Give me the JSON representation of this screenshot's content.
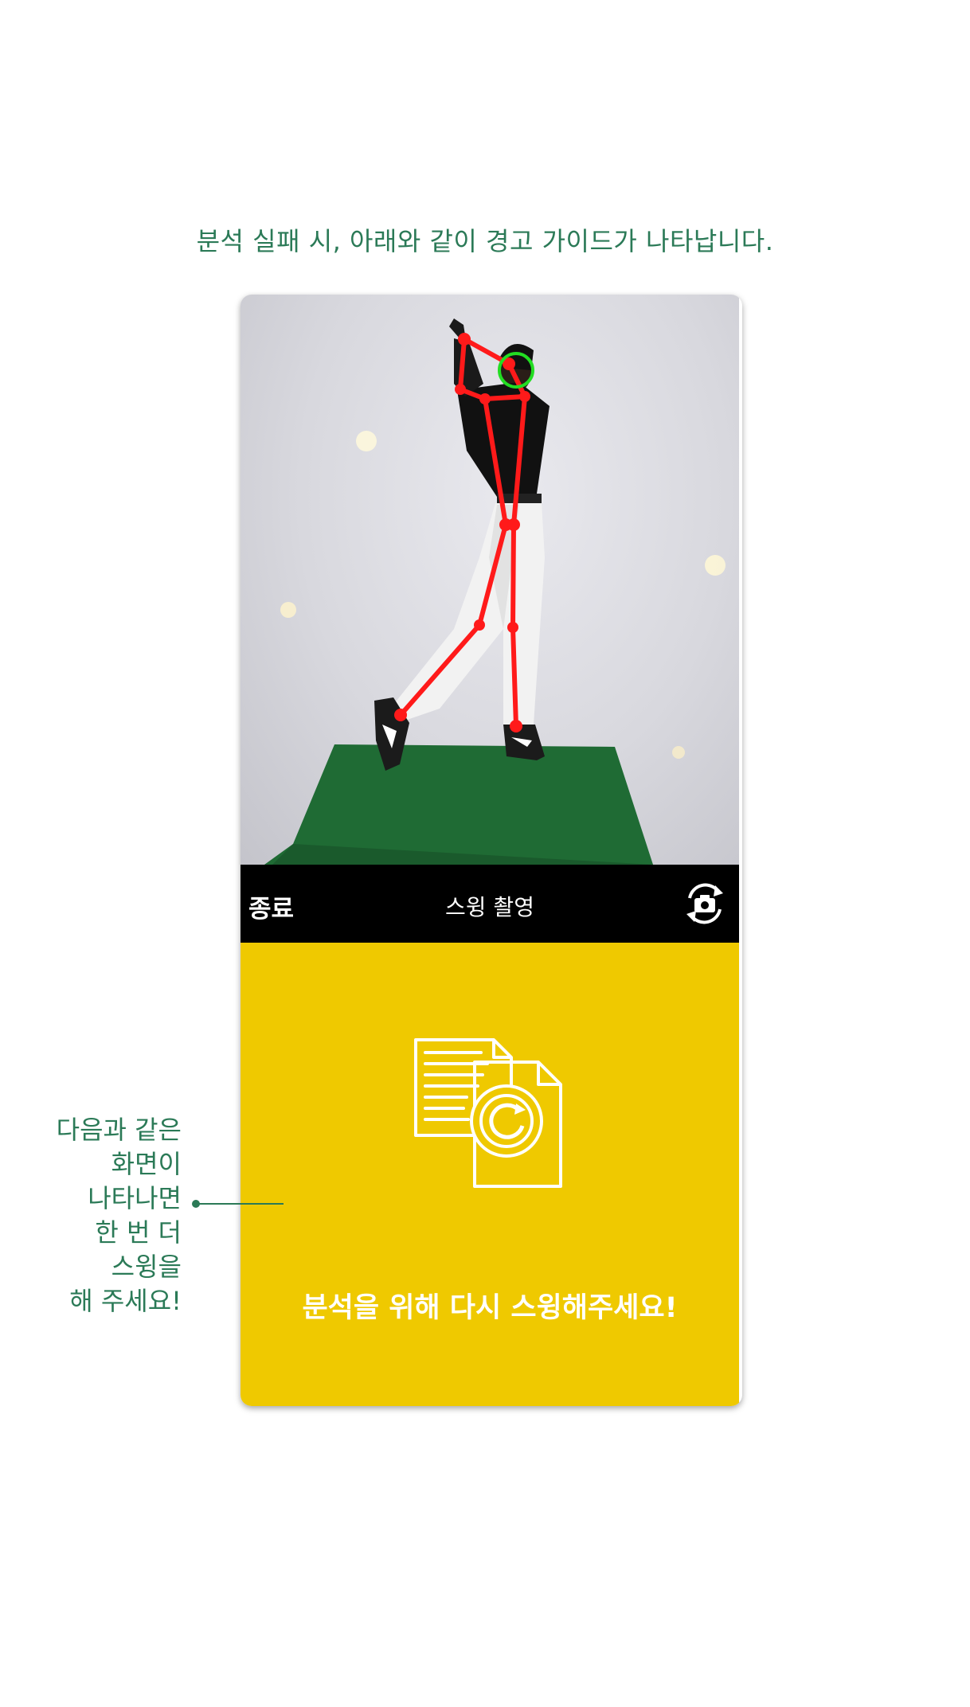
{
  "guide": {
    "title": "분석 실패 시, 아래와 같이 경고 가이드가 나타납니다."
  },
  "phone": {
    "toolbar": {
      "exit_label": "종료",
      "title": "스윙 촬영",
      "switch_icon": "camera-switch-icon"
    },
    "warning": {
      "icon": "document-refresh-icon",
      "message": "분석을 위해 다시 스윙해주세요!"
    }
  },
  "side_note": {
    "lines": [
      "다음과 같은",
      "화면이",
      "나타나면",
      "한 번 더",
      "스윙을",
      "해 주세요!"
    ]
  },
  "colors": {
    "accent_text": "#2b7a57",
    "warning_bg": "#efc900",
    "toolbar_bg": "#000000",
    "skeleton": "#ff0000",
    "head_marker": "#22dd22"
  }
}
